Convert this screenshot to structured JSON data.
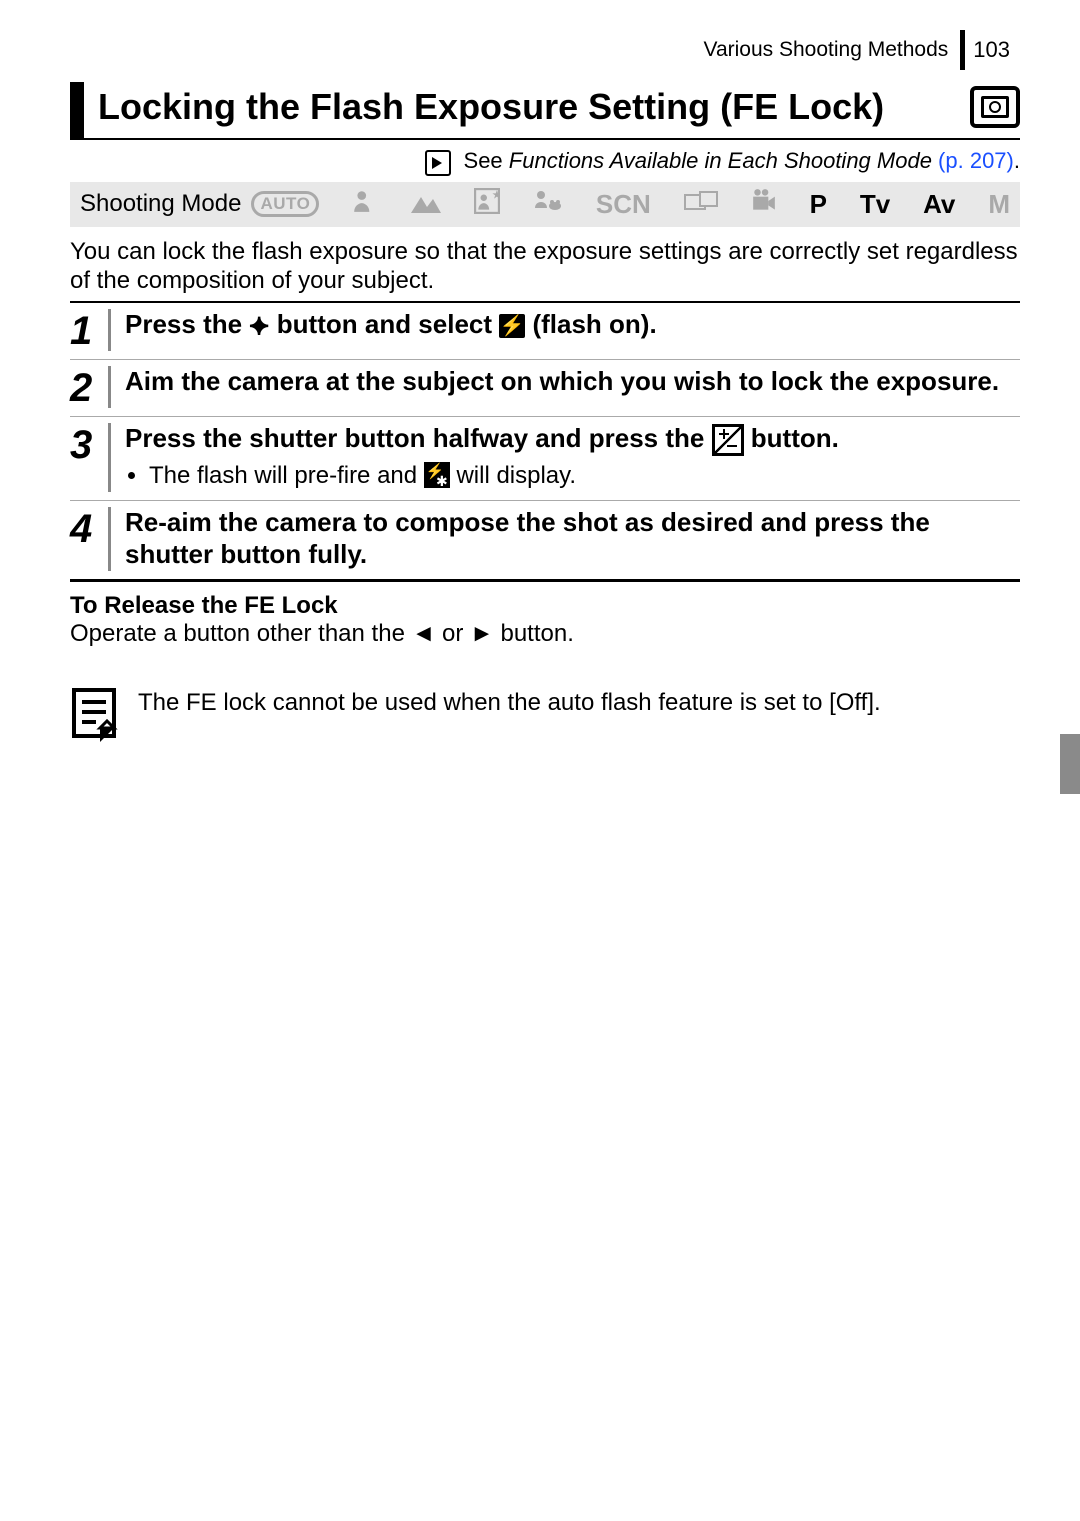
{
  "header": {
    "section_name": "Various Shooting Methods",
    "page_number": "103"
  },
  "title": "Locking the Flash Exposure Setting (FE Lock)",
  "see_also": {
    "prefix": "See ",
    "link_text": "Functions Available in Each Shooting Mode",
    "page_ref": " (p. 207)",
    "period": "."
  },
  "shooting_mode": {
    "label": "Shooting Mode",
    "icons": {
      "auto": "AUTO",
      "scn": "SCN",
      "p": "P",
      "tv": "Tv",
      "av": "Av",
      "m": "M"
    }
  },
  "intro": "You can lock the flash exposure so that the exposure settings are correctly set regardless of the composition of your subject.",
  "steps": [
    {
      "num": "1",
      "pre": "Press the ",
      "mid": " button and select ",
      "post": " (flash on)."
    },
    {
      "num": "2",
      "text": "Aim the camera at the subject on which you wish to lock the exposure."
    },
    {
      "num": "3",
      "line1": "Press the shutter button halfway and press the ",
      "line2": " button.",
      "bullet_pre": "The flash will pre-fire and ",
      "bullet_post": " will display."
    },
    {
      "num": "4",
      "text": "Re-aim the camera to compose the shot as desired and press the shutter button fully."
    }
  ],
  "release": {
    "title": "To Release the FE Lock",
    "pre": "Operate a button other than the ",
    "mid": " or ",
    "post": " button."
  },
  "note": "The FE lock cannot be used when the auto flash feature is set to [Off]."
}
